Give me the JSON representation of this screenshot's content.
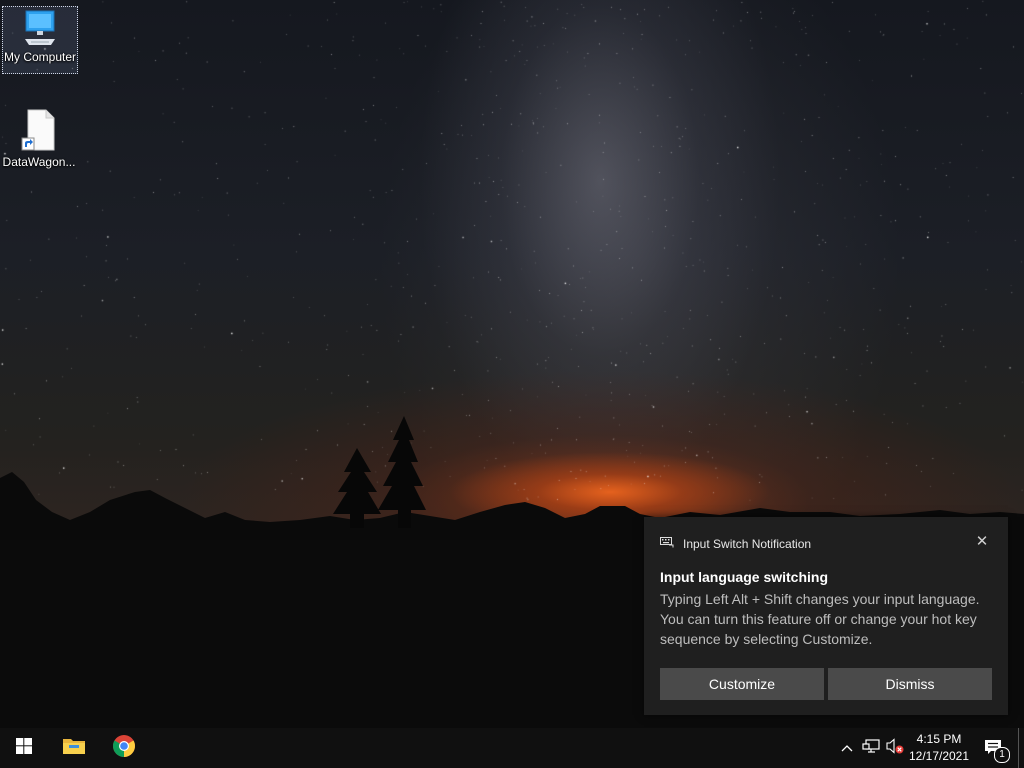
{
  "desktop": {
    "icons": [
      {
        "label": "My Computer",
        "icon": "computer-icon",
        "selected": true
      },
      {
        "label": "DataWagon...",
        "icon": "file-shortcut-icon",
        "selected": false
      }
    ]
  },
  "notification": {
    "app_name": "Input Switch Notification",
    "app_icon": "keyboard-icon",
    "title": "Input language switching",
    "body": "Typing Left Alt + Shift changes your input language. You can turn this feature off or change your hot key sequence by selecting Customize.",
    "buttons": {
      "customize": "Customize",
      "dismiss": "Dismiss"
    },
    "close_icon": "close-icon"
  },
  "taskbar": {
    "start_icon": "windows-start-icon",
    "pinned": [
      {
        "name": "file-explorer-icon"
      },
      {
        "name": "chrome-icon"
      }
    ],
    "tray": {
      "chevron": "chevron-up-icon",
      "network": "network-icon",
      "volume": "volume-muted-icon"
    },
    "clock": {
      "time": "4:15 PM",
      "date": "12/17/2021"
    },
    "action_center": {
      "icon": "action-center-icon",
      "badge": "1"
    }
  },
  "colors": {
    "toast_bg": "#1f1f1f",
    "button_bg": "#4a4a4a",
    "taskbar_bg": "#101010",
    "windows_blue": "#0078d7"
  }
}
